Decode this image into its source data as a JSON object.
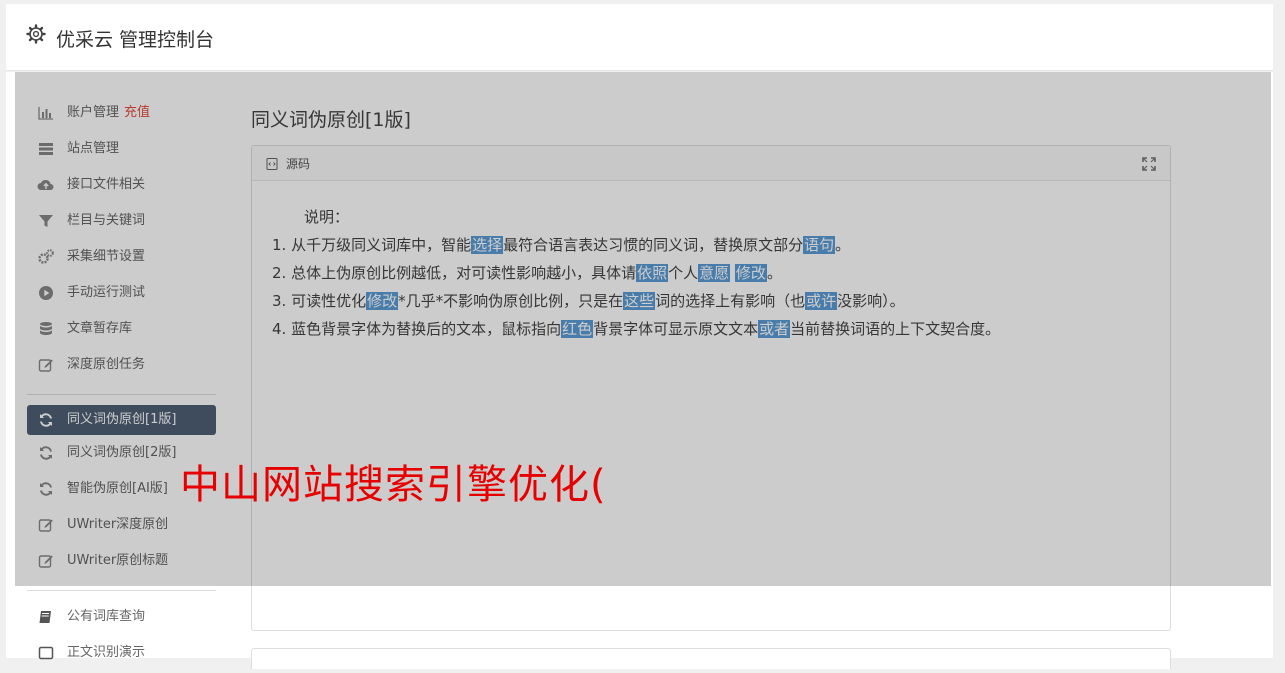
{
  "header": {
    "title": "优采云 管理控制台"
  },
  "sidebar": {
    "group1": [
      {
        "label": "账户管理",
        "tag": "充值",
        "icon": "bar-chart-icon"
      },
      {
        "label": "站点管理",
        "icon": "server-icon"
      },
      {
        "label": "接口文件相关",
        "icon": "cloud-upload-icon"
      },
      {
        "label": "栏目与关键词",
        "icon": "filter-icon"
      },
      {
        "label": "采集细节设置",
        "icon": "gears-icon"
      },
      {
        "label": "手动运行测试",
        "icon": "play-circle-icon"
      },
      {
        "label": "文章暂存库",
        "icon": "database-icon"
      },
      {
        "label": "深度原创任务",
        "icon": "edit-icon"
      }
    ],
    "group2": [
      {
        "label": "同义词伪原创[1版]",
        "icon": "refresh-icon",
        "active": true
      },
      {
        "label": "同义词伪原创[2版]",
        "icon": "refresh-icon"
      },
      {
        "label": "智能伪原创[AI版]",
        "icon": "refresh-icon"
      },
      {
        "label": "UWriter深度原创",
        "icon": "edit-icon"
      },
      {
        "label": "UWriter原创标题",
        "icon": "edit-icon"
      }
    ],
    "group3": [
      {
        "label": "公有词库查询",
        "icon": "book-icon"
      },
      {
        "label": "正文识别演示",
        "icon": "square-icon"
      }
    ]
  },
  "main": {
    "title": "同义词伪原创[1版]",
    "panel_label": "源码",
    "intro": "说明：",
    "lines": [
      {
        "pre": "1. 从千万级同义词库中，智能",
        "h1": "选择",
        "mid": "最符合语言表达习惯的同义词，替换原文部分",
        "h2": "语句",
        "post": "。"
      },
      {
        "pre": "2. 总体上伪原创比例越低，对可读性影响越小，具体请",
        "h1": "依照",
        "mid": "个人",
        "h2": "意愿",
        "mid2": " ",
        "h3": "修改",
        "post": "。"
      },
      {
        "pre": "3. 可读性优化",
        "h1": "修改",
        "mid": "*几乎*不影响伪原创比例，只是在",
        "h2": "这些",
        "mid2": "词的选择上有影响（也",
        "h3": "或许",
        "post": "没影响）。"
      },
      {
        "pre": "4. 蓝色背景字体为替换后的文本，鼠标指向",
        "h1": "红色",
        "mid": "背景字体可显示原文文本",
        "h2": "或者",
        "post": "当前替换词语的上下文契合度。"
      }
    ]
  },
  "watermark": "中山网站搜索引擎优化(",
  "colors": {
    "active_bg": "#4f5f75",
    "highlight": "#5b9bd5",
    "tag": "#e74c3c",
    "watermark": "#e60000"
  }
}
